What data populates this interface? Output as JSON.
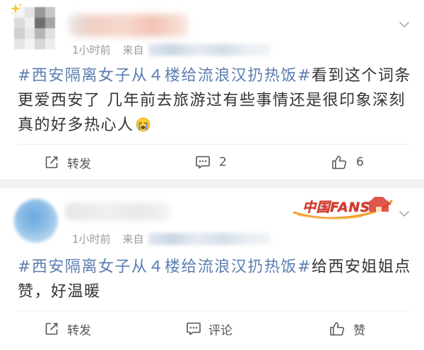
{
  "colors": {
    "text": "#333333",
    "hashtag": "#5b7db1",
    "meta": "#9a9a9a",
    "action": "#555555",
    "separator": "#f2f2f2",
    "badge": "#d93a2b"
  },
  "feed": {
    "posts": [
      {
        "avatar_icon": "avatar-icon",
        "avatar_decoration_icon": "sparkle-icon",
        "menu_icon": "chevron-down-icon",
        "time": "1小时前",
        "source_label": "来自",
        "content": {
          "hashtag": "#西安隔离女子从４楼给流浪汉扔热饭#",
          "lines": [
            "看到这个词条",
            "更爱西安了 几年前去旅游过有些事情还是很印象深刻",
            "真的好多热心人"
          ],
          "emoji_icon": "loudly-crying-face-icon"
        },
        "actions": [
          {
            "icon": "repost-icon",
            "label": "转发"
          },
          {
            "icon": "comment-icon",
            "label": "2"
          },
          {
            "icon": "like-icon",
            "label": "6"
          }
        ]
      },
      {
        "avatar_icon": "avatar-icon",
        "menu_icon": "chevron-down-icon",
        "badge": "中国FANS",
        "time": "1小时前",
        "source_label": "来自",
        "content": {
          "hashtag": "#西安隔离女子从４楼给流浪汉扔热饭#",
          "lines": [
            "给西安姐姐点",
            "赞，好温暖"
          ]
        },
        "actions": [
          {
            "icon": "repost-icon",
            "label": "转发"
          },
          {
            "icon": "comment-icon",
            "label": "评论"
          },
          {
            "icon": "like-icon",
            "label": "赞"
          }
        ]
      }
    ]
  }
}
